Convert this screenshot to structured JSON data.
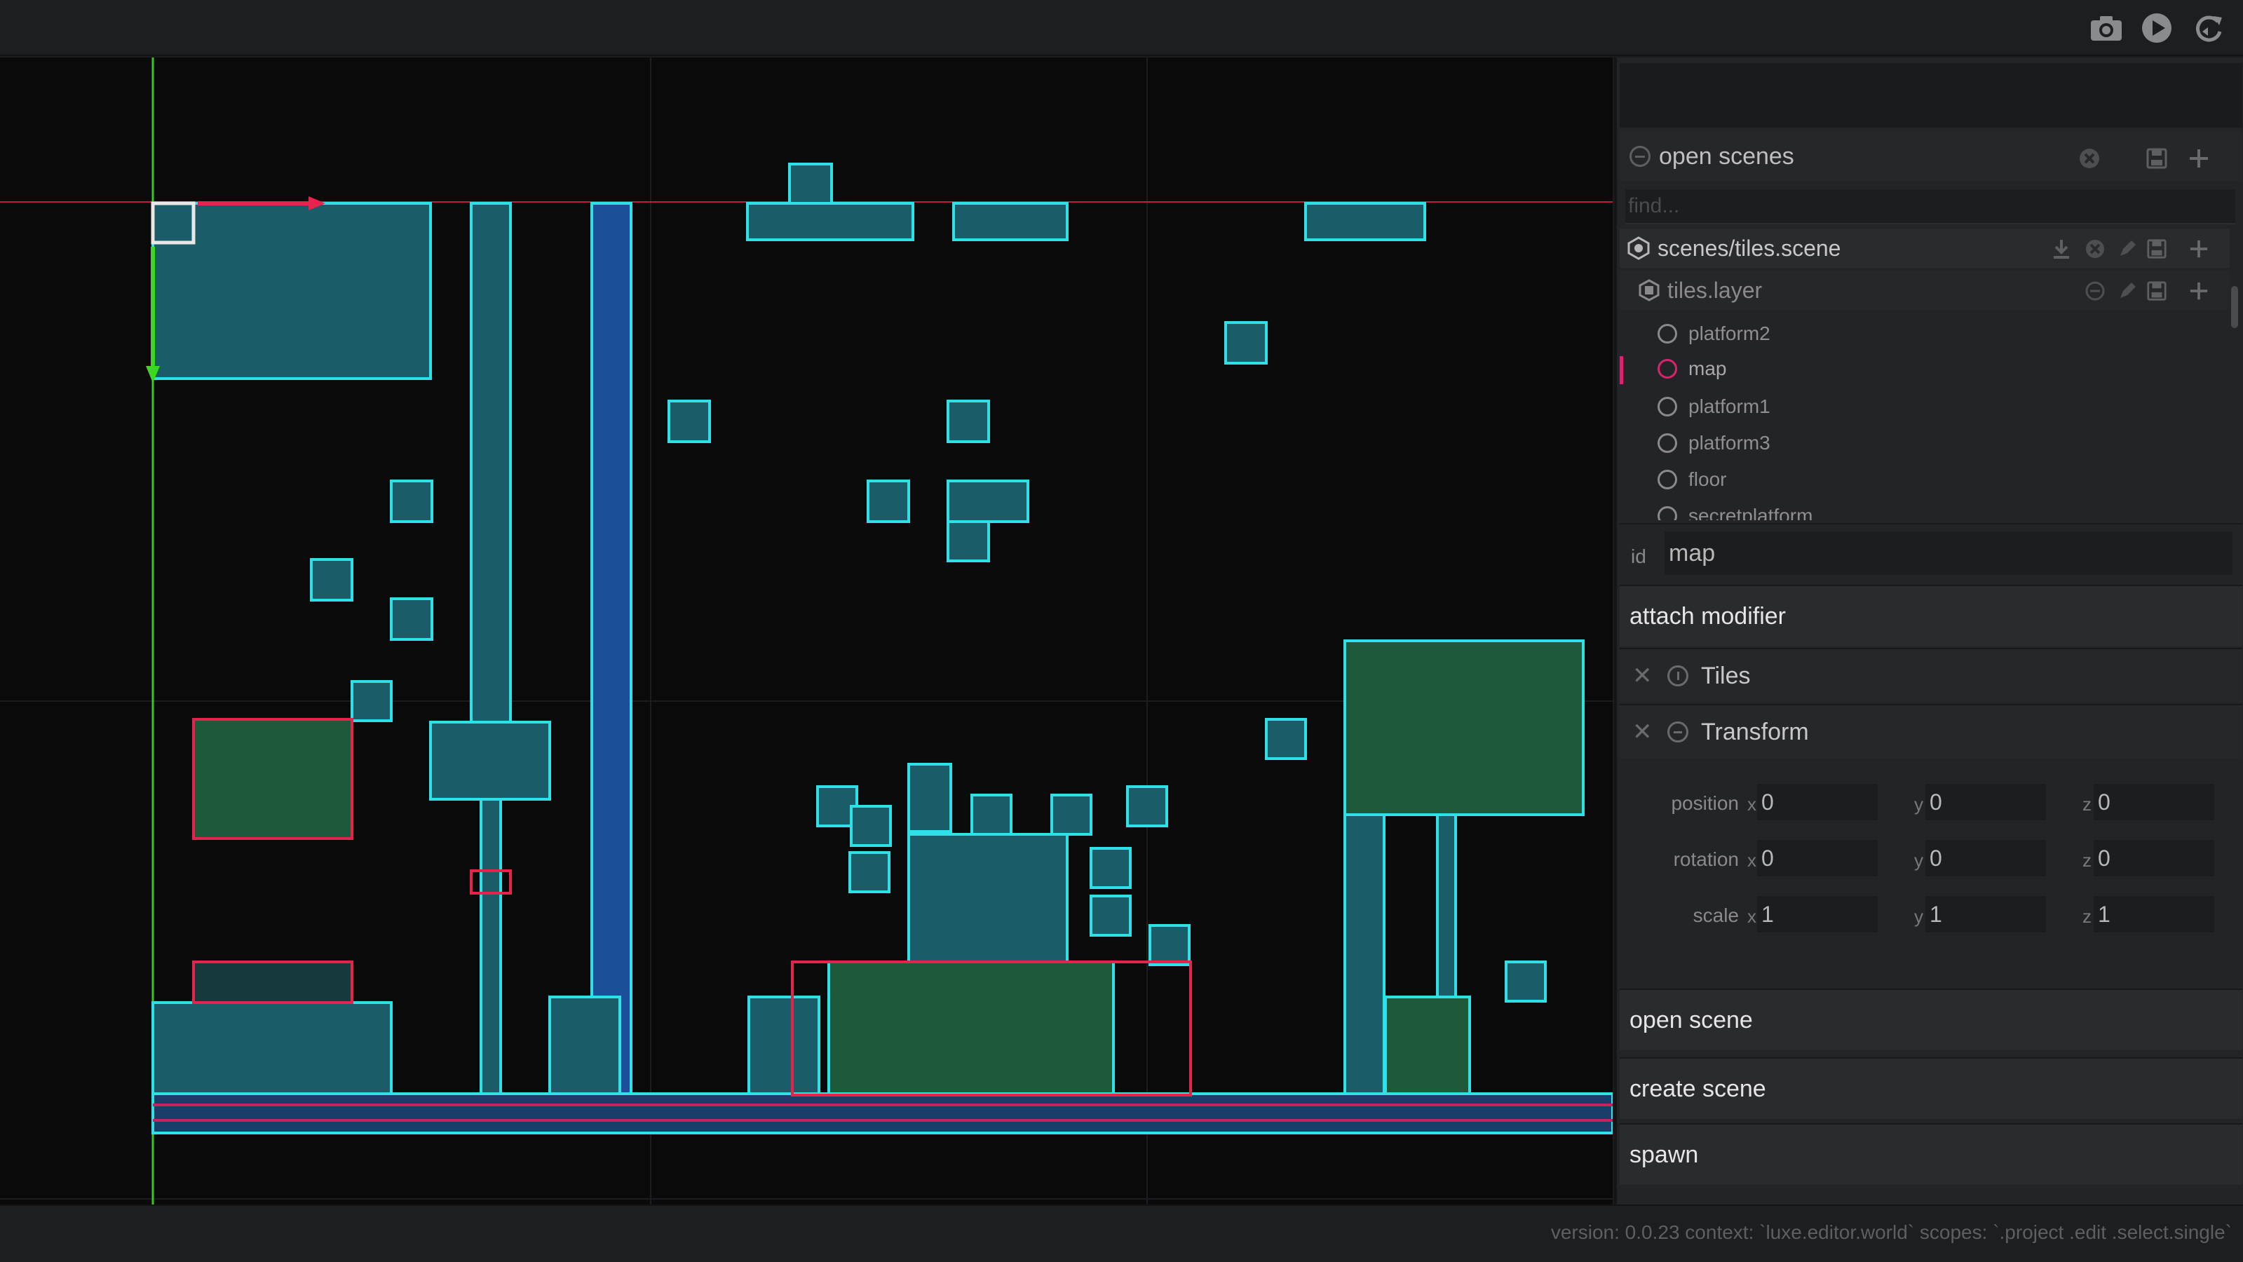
{
  "toolbar": {
    "icons": [
      "camera-icon",
      "play-icon",
      "refresh-icon"
    ]
  },
  "open_scenes": {
    "title": "open scenes",
    "find_placeholder": "find..."
  },
  "tree": {
    "scene": "scenes/tiles.scene",
    "layer": "tiles.layer",
    "nodes": [
      {
        "label": "platform2",
        "selected": false
      },
      {
        "label": "map",
        "selected": true
      },
      {
        "label": "platform1",
        "selected": false
      },
      {
        "label": "platform3",
        "selected": false
      },
      {
        "label": "floor",
        "selected": false
      },
      {
        "label": "secretplatform",
        "selected": false
      }
    ]
  },
  "inspector": {
    "id_label": "id",
    "id_value": "map",
    "attach_modifier": "attach modifier",
    "modifiers": [
      "Tiles",
      "Transform"
    ],
    "transform": {
      "position_label": "position",
      "rotation_label": "rotation",
      "scale_label": "scale",
      "axis_x": "x",
      "axis_y": "y",
      "axis_z": "z",
      "position": [
        "0",
        "0",
        "0"
      ],
      "rotation": [
        "0",
        "0",
        "0"
      ],
      "scale": [
        "1",
        "1",
        "1"
      ]
    },
    "open_scene": "open scene",
    "create_scene": "create scene",
    "spawn": "spawn"
  },
  "status": {
    "text": "version: 0.0.23 context: `luxe.editor.world` scopes: `.project .edit .select.single`"
  },
  "colors": {
    "accent": "#d8246c",
    "tile_outline": "#2ee0e8",
    "axis_x": "#e8244c",
    "axis_y": "#3cd820"
  }
}
